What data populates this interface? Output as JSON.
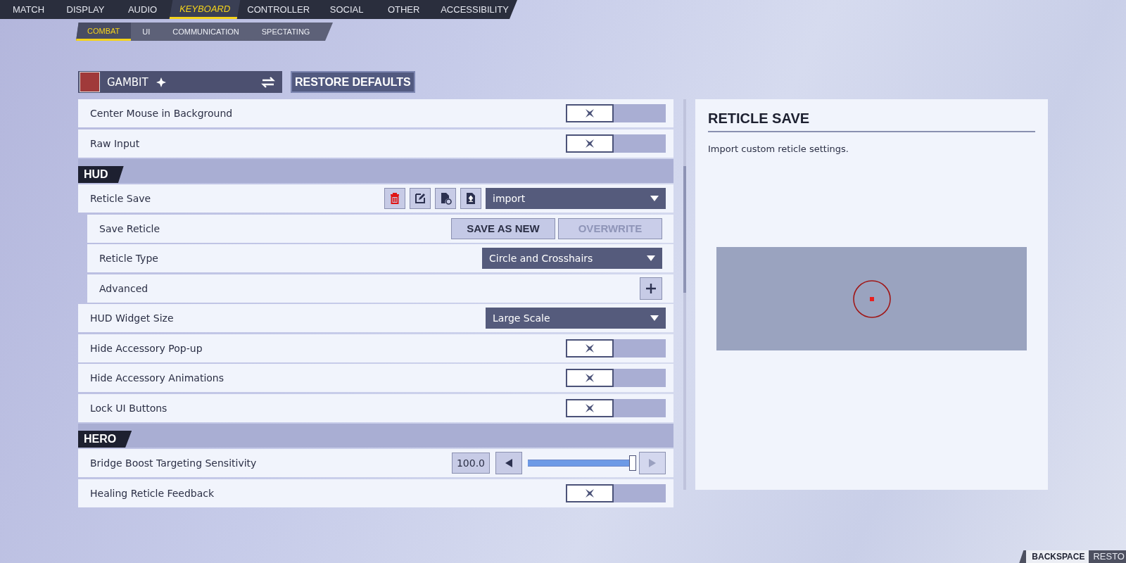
{
  "top_tabs": [
    {
      "label": "MATCH",
      "selected": false
    },
    {
      "label": "DISPLAY",
      "selected": false
    },
    {
      "label": "AUDIO",
      "selected": false
    },
    {
      "label": "KEYBOARD",
      "selected": true
    },
    {
      "label": "CONTROLLER",
      "selected": false
    },
    {
      "label": "SOCIAL",
      "selected": false
    },
    {
      "label": "OTHER",
      "selected": false
    },
    {
      "label": "ACCESSIBILITY",
      "selected": false
    }
  ],
  "sub_tabs": [
    {
      "label": "COMBAT",
      "selected": true
    },
    {
      "label": "UI",
      "selected": false
    },
    {
      "label": "COMMUNICATION",
      "selected": false
    },
    {
      "label": "SPECTATING",
      "selected": false
    }
  ],
  "hero_selector": {
    "name": "GAMBIT"
  },
  "restore_button": "RESTORE DEFAULTS",
  "settings": [
    {
      "kind": "toggle",
      "label": "Center Mouse in Background",
      "on": false
    },
    {
      "kind": "toggle",
      "label": "Raw Input",
      "on": false
    },
    {
      "kind": "section",
      "label": "HUD"
    },
    {
      "kind": "reticle_save",
      "label": "Reticle Save",
      "value": "import",
      "children": [
        {
          "kind": "buttons",
          "label": "Save Reticle",
          "buttons": [
            {
              "label": "SAVE AS NEW",
              "disabled": false
            },
            {
              "label": "OVERWRITE",
              "disabled": true
            }
          ]
        },
        {
          "kind": "dropdown",
          "label": "Reticle Type",
          "value": "Circle and Crosshairs"
        },
        {
          "kind": "expand",
          "label": "Advanced",
          "expanded": false
        }
      ]
    },
    {
      "kind": "dropdown",
      "label": "HUD Widget Size",
      "value": "Large Scale"
    },
    {
      "kind": "toggle",
      "label": "Hide Accessory Pop-up",
      "on": false
    },
    {
      "kind": "toggle",
      "label": "Hide Accessory Animations",
      "on": false
    },
    {
      "kind": "toggle",
      "label": "Lock UI Buttons",
      "on": false
    },
    {
      "kind": "section",
      "label": "HERO"
    },
    {
      "kind": "slider",
      "label": "Bridge Boost Targeting Sensitivity",
      "reading": "100.0",
      "level": 1.0
    },
    {
      "kind": "toggle",
      "label": "Healing Reticle Feedback",
      "on": false
    }
  ],
  "detail": {
    "title": "RETICLE SAVE",
    "description": "Import custom reticle settings."
  },
  "footer": {
    "key": "BACKSPACE",
    "action": "RESTO"
  }
}
